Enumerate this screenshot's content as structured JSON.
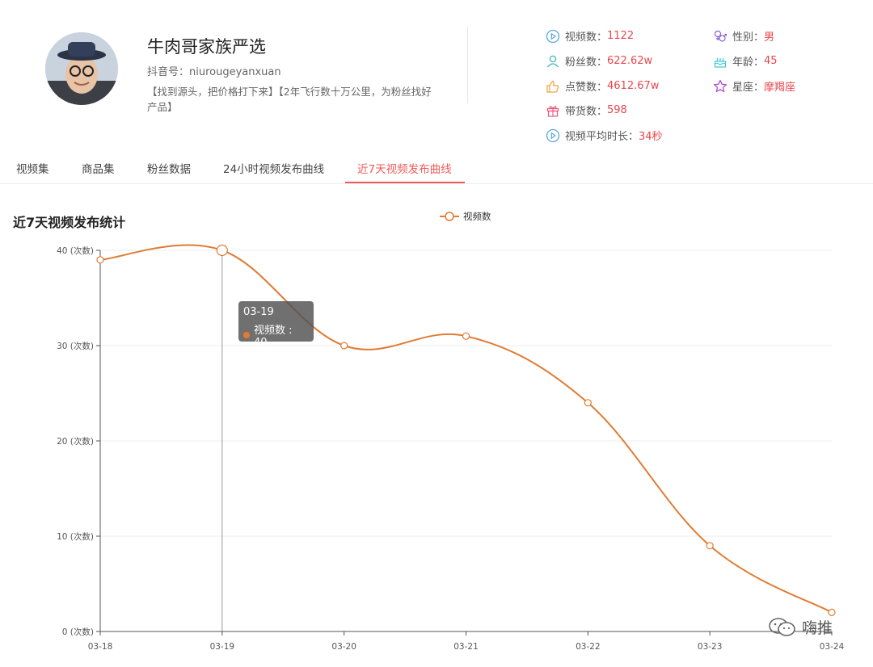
{
  "profile": {
    "name": "牛肉哥家族严选",
    "account": "抖音号：niurougeyanxuan",
    "bio": "【找到源头，把价格打下来】【2年飞行数十万公里，为粉丝找好产品】"
  },
  "stats": {
    "videos": {
      "label": "视频数：",
      "value": "1122"
    },
    "fans": {
      "label": "粉丝数：",
      "value": "622.62w"
    },
    "likes": {
      "label": "点赞数：",
      "value": "4612.67w"
    },
    "goods": {
      "label": "带货数：",
      "value": "598"
    },
    "avg_duration": {
      "label": "视频平均时长：",
      "value": "34秒"
    },
    "gender": {
      "label": "性别：",
      "value": "男"
    },
    "age": {
      "label": "年龄：",
      "value": "45"
    },
    "constellation": {
      "label": "星座：",
      "value": "摩羯座"
    }
  },
  "tabs": [
    {
      "label": "视频集"
    },
    {
      "label": "商品集"
    },
    {
      "label": "粉丝数据"
    },
    {
      "label": "24小时视频发布曲线"
    },
    {
      "label": "近7天视频发布曲线",
      "active": true
    }
  ],
  "chart": {
    "title": "近7天视频发布统计",
    "legend": "视频数",
    "tooltip": {
      "date": "03-19",
      "text": "视频数 : 40"
    }
  },
  "chart_data": {
    "type": "line",
    "title": "近7天视频发布统计",
    "categories": [
      "03-18",
      "03-19",
      "03-20",
      "03-21",
      "03-22",
      "03-23",
      "03-24"
    ],
    "series": [
      {
        "name": "视频数",
        "values": [
          39,
          40,
          30,
          31,
          24,
          9,
          2
        ]
      }
    ],
    "ylim": [
      0,
      40
    ],
    "yticks": [
      0,
      10,
      20,
      30,
      40
    ],
    "ytick_labels": [
      "0 (次数)",
      "10 (次数)",
      "20 (次数)",
      "30 (次数)",
      "40 (次数)"
    ],
    "grid": true,
    "legend_position": "top-center",
    "color": "#e07b33"
  },
  "watermark": {
    "text": "嗨推"
  }
}
